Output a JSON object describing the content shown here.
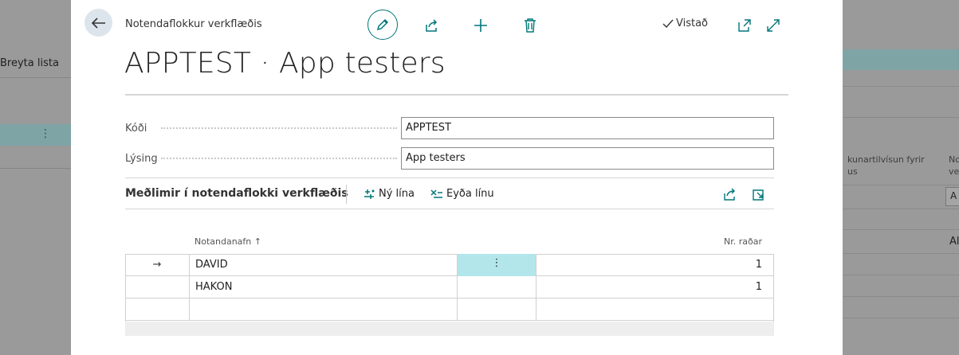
{
  "background": {
    "edit_list_label": "Breyta lista",
    "column_header_1": "kunartilvísun fyrir\nus",
    "column_header_2": "No\nve",
    "cell_values": [
      "A",
      "Al"
    ]
  },
  "dialog": {
    "breadcrumb": "Notendaflokkur verkflæðis",
    "viewed_label": "Vistað",
    "title": "APPTEST · App testers",
    "actions": [
      "edit-icon",
      "share-icon",
      "new-icon",
      "delete-icon",
      "open-new-window-icon",
      "expand-icon"
    ]
  },
  "fields": {
    "code_label": "Kóði",
    "code_value": "APPTEST",
    "description_label": "Lýsing",
    "description_value": "App testers"
  },
  "subpage": {
    "title": "Meðlimir í notendaflokki verkflæðis",
    "new_line_label": "Ný lína",
    "delete_line_label": "Eyða línu",
    "columns": {
      "username": "Notandanafn",
      "sort_indicator": "↑",
      "sequence": "Nr. raðar"
    },
    "rows": [
      {
        "marker": "→",
        "username": "DAVID",
        "sequence": "1"
      },
      {
        "marker": "",
        "username": "HAKON",
        "sequence": "1"
      },
      {
        "marker": "",
        "username": "",
        "sequence": ""
      }
    ]
  },
  "colors": {
    "accent": "#00767a",
    "selected_cell": "#b3e6eb",
    "background_band": "#7ea4a6"
  }
}
